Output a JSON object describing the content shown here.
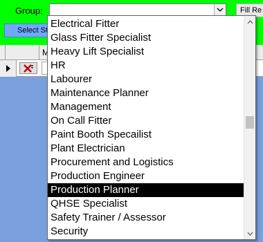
{
  "toolbar": {
    "group_label": "Group:",
    "group_value": "",
    "fill_button_label": "Fill Re",
    "select_button_label": "Select St"
  },
  "grid": {
    "column_header": "M",
    "row_indicator": "▶"
  },
  "dropdown": {
    "items": [
      "Electrical Fitter",
      "Glass Fitter Specialist",
      "Heavy Lift Specialist",
      "HR",
      "Labourer",
      "Maintenance Planner",
      "Management",
      "On Call Fitter",
      "Paint Booth Specailist",
      "Plant Electrician",
      "Procurement and Logistics",
      "Production Engineer",
      "Production Planner",
      "QHSE Specialist",
      "Safety Trainer / Assessor",
      "Security"
    ],
    "selected_item": "Production Planner"
  },
  "colors": {
    "toolbar_background": "#00ff00",
    "grid_background": "#7a9fdd",
    "select_button": "#6fa8ff",
    "delete_icon": "#c00000",
    "selection_highlight": "#000000"
  },
  "icons": {
    "combo_dropdown": "chevron-down-icon",
    "delete_record": "delete-icon",
    "record_selector": "record-pointer-icon",
    "scroll_up": "scroll-up-arrow-icon",
    "scroll_down": "scroll-down-arrow-icon"
  }
}
